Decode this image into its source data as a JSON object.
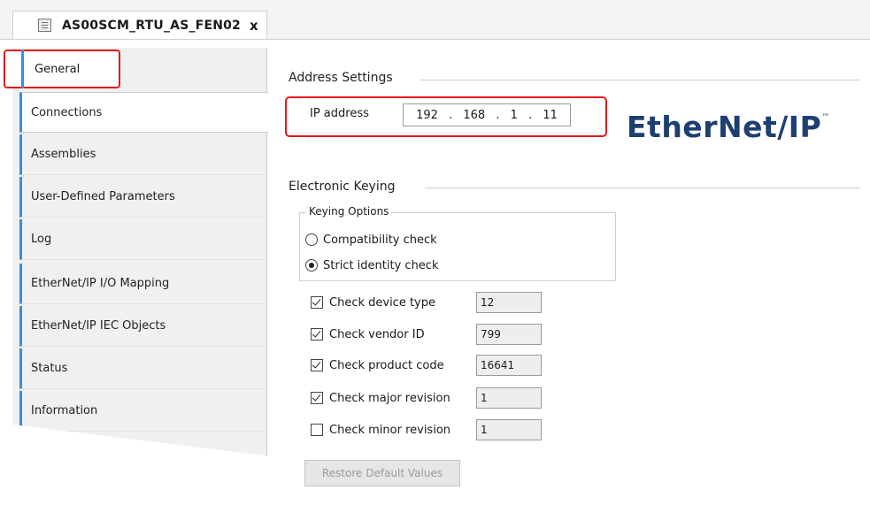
{
  "document_tab": {
    "title": "AS00SCM_RTU_AS_FEN02",
    "close_glyph": "x",
    "icon": "device-icon"
  },
  "sidebar": {
    "items": [
      {
        "label": "General"
      },
      {
        "label": "Connections"
      },
      {
        "label": "Assemblies"
      },
      {
        "label": "User-Defined Parameters"
      },
      {
        "label": "Log"
      },
      {
        "label": "EtherNet/IP I/O Mapping"
      },
      {
        "label": "EtherNet/IP IEC Objects"
      },
      {
        "label": "Status"
      },
      {
        "label": "Information"
      }
    ]
  },
  "address_settings": {
    "title": "Address Settings",
    "ip_label": "IP address",
    "ip_octets": [
      "192",
      "168",
      "1",
      "11"
    ],
    "ip_separator": "."
  },
  "logo": {
    "text_left": "Ether",
    "text_right": "et/IP",
    "n_glyph": "N",
    "tm": "™"
  },
  "electronic_keying": {
    "title": "Electronic Keying",
    "options_title": "Keying Options",
    "options": [
      {
        "label": "Compatibility check",
        "selected": false
      },
      {
        "label": "Strict identity check",
        "selected": true
      }
    ],
    "checks": [
      {
        "label": "Check device type",
        "checked": true,
        "value": "12"
      },
      {
        "label": "Check vendor ID",
        "checked": true,
        "value": "799"
      },
      {
        "label": "Check product code",
        "checked": true,
        "value": "16641"
      },
      {
        "label": "Check major revision",
        "checked": true,
        "value": "1"
      },
      {
        "label": "Check minor revision",
        "checked": false,
        "value": "1"
      }
    ],
    "restore_label": "Restore Default Values"
  },
  "colors": {
    "highlight": "#e1181c",
    "accent": "#3a8fd8",
    "logo": "#1e3f72"
  }
}
